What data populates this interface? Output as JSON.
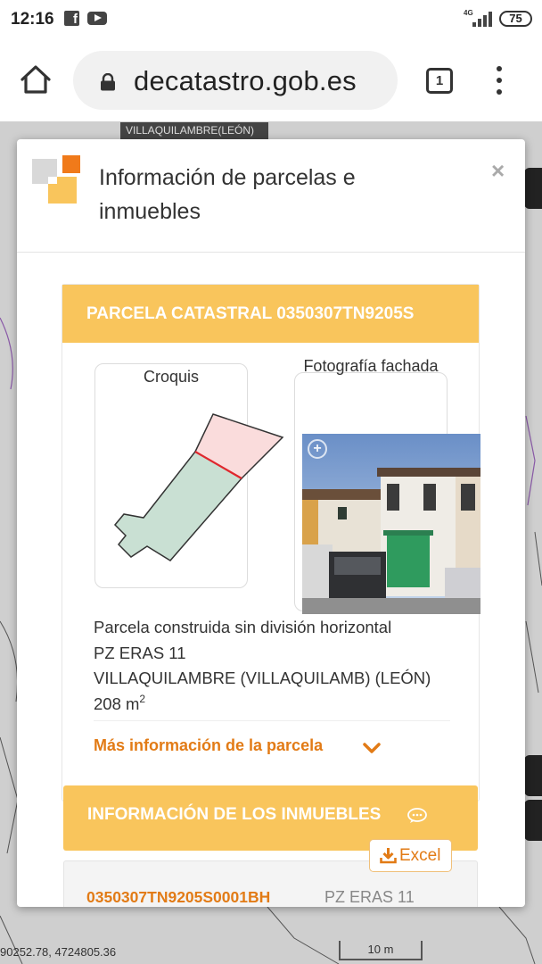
{
  "status_bar": {
    "time": "12:16",
    "notification_icons": [
      "facebook-icon",
      "youtube-icon"
    ],
    "network": "4G",
    "battery": "75"
  },
  "browser": {
    "url": "decatastro.gob.es",
    "tab_count": "1"
  },
  "map": {
    "municipality": "VILLAQUILAMBRE(LEÓN)",
    "coordinates": "90252.78, 4724805.36",
    "scale": "10 m"
  },
  "dialog": {
    "title": "Información de parcelas e inmuebles",
    "close_label": "×",
    "parcel": {
      "header": "PARCELA CATASTRAL 0350307TN9205S",
      "sketch_label": "Croquis",
      "photo_label": "Fotografía fachada",
      "type": "Parcela construida sin división horizontal",
      "address": "PZ ERAS 11",
      "municipality": "VILLAQUILAMBRE (VILLAQUILAMB) (LEÓN)",
      "area_value": "208 m",
      "area_exponent": "2",
      "more_info_link": "Más información de la parcela"
    },
    "inmuebles": {
      "header": "INFORMACIÓN DE LOS INMUEBLES",
      "excel_label": "Excel",
      "rows": [
        {
          "reference": "0350307TN9205S0001BH",
          "address": "PZ ERAS 11"
        }
      ]
    }
  },
  "colors": {
    "accent_yellow": "#f9c55c",
    "link_orange": "#e27b16",
    "sketch_parcel_fill": "#c9e0d3",
    "sketch_building_fill": "#fadcdc",
    "sketch_edge_red": "#e0282e"
  }
}
